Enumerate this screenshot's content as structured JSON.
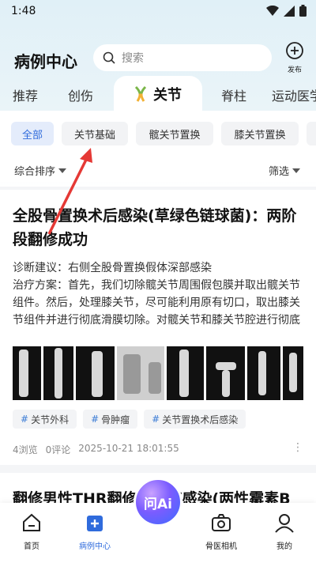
{
  "status_bar": {
    "time": "1:48"
  },
  "header": {
    "title": "病例中心",
    "search_placeholder": "搜索",
    "publish_label": "发布"
  },
  "tabs": [
    {
      "label": "推荐"
    },
    {
      "label": "创伤"
    },
    {
      "label": "关节",
      "active": true
    },
    {
      "label": "脊柱"
    },
    {
      "label": "运动医学"
    }
  ],
  "chips": [
    "全部",
    "关节基础",
    "髋关节置换",
    "膝关节置换"
  ],
  "sort": {
    "left": "综合排序",
    "right": "筛选"
  },
  "post": {
    "title": "全股骨置换术后感染(草绿色链球菌)：两阶段翻修成功",
    "desc": "诊断建议：右侧全股骨置换假体深部感染\n治疗方案：首先，我们切除髋关节周围假包膜并取出髋关节组件。然后，处理膝关节，尽可能利用原有切口，取出膝关节组件并进行彻底滑膜切除。对髋关节和膝关节腔进行彻底冲洗和清创...",
    "tags": [
      "关节外科",
      "骨肿瘤",
      "关节置换术后感染"
    ],
    "views": "4浏览",
    "comments": "0评论",
    "date": "2025-10-21 18:01:55"
  },
  "post2": {
    "title": "翻修男性THR翻修…关节感染(两性霉素B"
  },
  "nav": {
    "home": "首页",
    "cases": "病例中心",
    "ai": "问Ai",
    "camera": "骨医相机",
    "mine": "我的"
  },
  "colors": {
    "accent": "#2f6bdc",
    "arrow": "#e53935"
  }
}
